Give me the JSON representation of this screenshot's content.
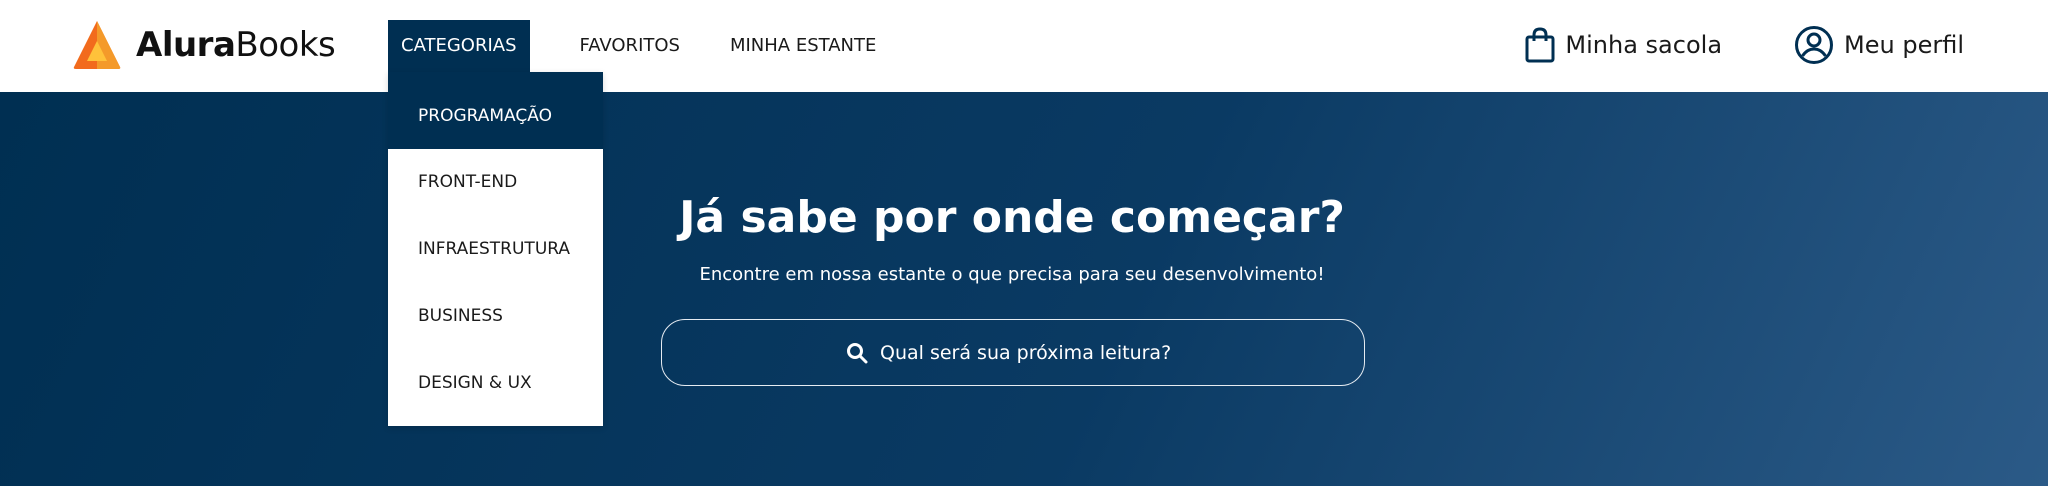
{
  "header": {
    "logo": {
      "part1": "Alura",
      "part2": "Books"
    },
    "nav": [
      {
        "label": "CATEGORIAS"
      },
      {
        "label": "FAVORITOS"
      },
      {
        "label": "MINHA ESTANTE"
      }
    ],
    "bag_label": "Minha sacola",
    "profile_label": "Meu perfil"
  },
  "dropdown": {
    "items": [
      {
        "label": "PROGRAMAÇÃO"
      },
      {
        "label": "FRONT-END"
      },
      {
        "label": "INFRAESTRUTURA"
      },
      {
        "label": "BUSINESS"
      },
      {
        "label": "DESIGN & UX"
      }
    ]
  },
  "hero": {
    "title": "Já sabe por onde começar?",
    "subtitle": "Encontre em nossa estante o que precisa para seu desenvolvimento!",
    "search_placeholder": "Qual será sua próxima leitura?"
  },
  "colors": {
    "brand_blue": "#002F52",
    "logo_orange": "#F26B1D"
  },
  "icons": {
    "logo": "logo-triangle-icon",
    "bag": "shopping-bag-icon",
    "profile": "user-circle-icon",
    "search": "search-icon"
  }
}
